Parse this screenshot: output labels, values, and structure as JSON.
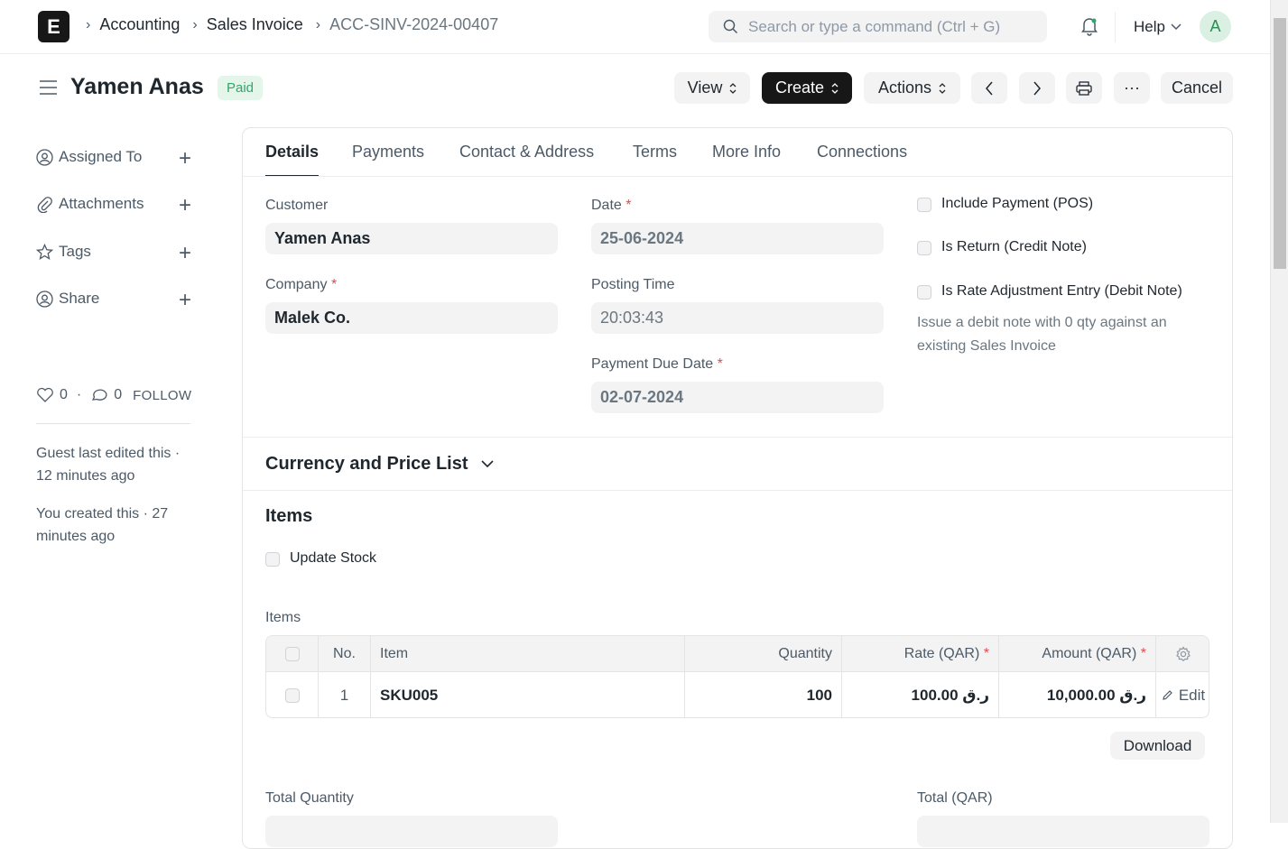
{
  "breadcrumbs": [
    "Accounting",
    "Sales Invoice",
    "ACC-SINV-2024-00407"
  ],
  "logo_letter": "E",
  "search": {
    "placeholder": "Search or type a command (Ctrl + G)"
  },
  "help_label": "Help",
  "avatar_initial": "A",
  "page": {
    "title": "Yamen Anas",
    "status": "Paid"
  },
  "toolbar": {
    "view": "View",
    "create": "Create",
    "actions": "Actions",
    "more": "···",
    "cancel": "Cancel"
  },
  "sidebar": {
    "items": [
      {
        "label": "Assigned To"
      },
      {
        "label": "Attachments"
      },
      {
        "label": "Tags"
      },
      {
        "label": "Share"
      }
    ],
    "likes": "0",
    "comments": "0",
    "follow": "FOLLOW",
    "activity": [
      "Guest last edited this · 12 minutes ago",
      "You created this · 27 minutes ago"
    ]
  },
  "tabs": [
    "Details",
    "Payments",
    "Contact & Address",
    "Terms",
    "More Info",
    "Connections"
  ],
  "form": {
    "customer_label": "Customer",
    "customer": "Yamen Anas",
    "company_label": "Company",
    "company": "Malek Co.",
    "date_label": "Date",
    "date": "25-06-2024",
    "posting_time_label": "Posting Time",
    "posting_time": "20:03:43",
    "due_date_label": "Payment Due Date",
    "due_date": "02-07-2024",
    "include_payment": "Include Payment (POS)",
    "is_return": "Is Return (Credit Note)",
    "is_rate_adj": "Is Rate Adjustment Entry (Debit Note)",
    "rate_adj_desc": "Issue a debit note with 0 qty against an existing Sales Invoice",
    "required_mark": "*"
  },
  "sections": {
    "currency": "Currency and Price List",
    "items": "Items",
    "update_stock": "Update Stock",
    "items_table_label": "Items"
  },
  "items_table": {
    "headers": {
      "no": "No.",
      "item": "Item",
      "qty": "Quantity",
      "rate": "Rate (QAR)",
      "amount": "Amount (QAR)"
    },
    "rows": [
      {
        "no": "1",
        "item": "SKU005",
        "qty": "100",
        "rate": "100.00 ر.ق",
        "amount": "10,000.00 ر.ق",
        "edit": "Edit"
      }
    ]
  },
  "download_label": "Download",
  "totals": {
    "total_qty_label": "Total Quantity",
    "total_label": "Total (QAR)"
  }
}
